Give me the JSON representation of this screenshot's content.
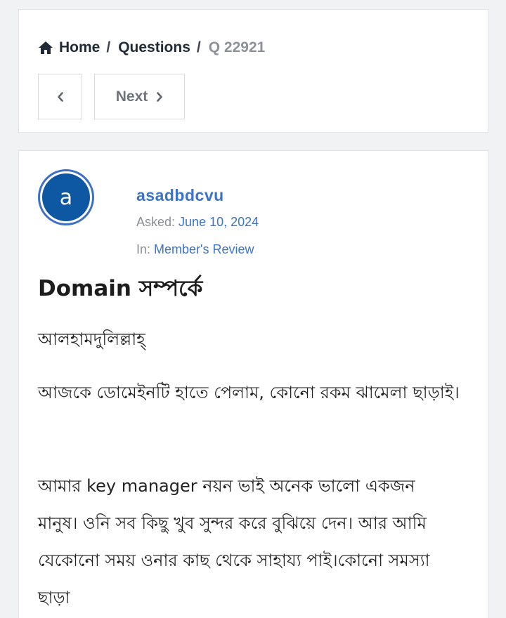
{
  "breadcrumb": {
    "home": "Home",
    "sep1": "/",
    "questions": "Questions",
    "sep2": "/",
    "current": "Q 22921"
  },
  "nav": {
    "next_label": "Next"
  },
  "question": {
    "avatar_letter": "a",
    "author": "asadbdcvu",
    "asked_label": "Asked:",
    "asked_date": "June 10, 2024",
    "in_label": "In:",
    "category": "Member's Review",
    "title": "Domain সম্পর্কে",
    "paragraphs": [
      "আলহামদুলিল্লাহ্",
      "আজকে ডোমেইনটি হাতে পেলাম, কোনো রকম ঝামেলা ছাড়াই।",
      "আমার key manager নয়ন ভাই অনেক ভালো একজন মানুষ। ওনি  সব কিছু খুব সুন্দর করে বুঝিয়ে দেন। আর আমি যেকোনো সময় ওনার কাছ থেকে সাহায্য পাই।কোনো সমস্যা ছাড়া"
    ]
  },
  "colors": {
    "link": "#3c73c7",
    "avatar_bg": "#0e57a3",
    "page_bg": "#f1f2f4"
  }
}
